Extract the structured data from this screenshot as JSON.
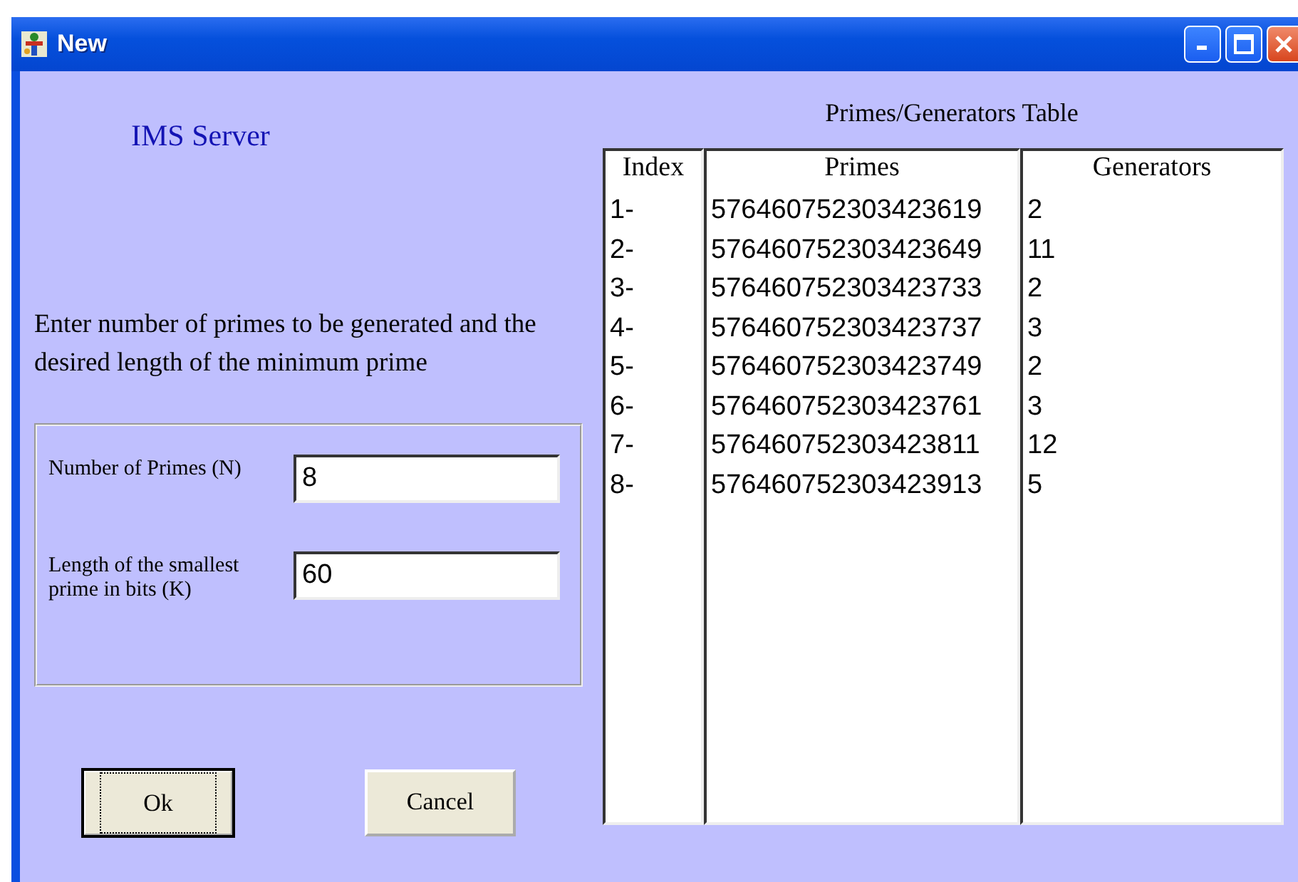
{
  "window": {
    "title": "New"
  },
  "heading": "IMS Server",
  "instructions": "Enter number of primes to be generated and the desired length of the minimum prime",
  "fields": [
    {
      "label": "Number of Primes (N)",
      "value": "8"
    },
    {
      "label": "Length of the smallest prime in bits (K)",
      "value": "60"
    }
  ],
  "buttons": [
    {
      "label": "Ok",
      "default": true
    },
    {
      "label": "Cancel",
      "default": false
    }
  ],
  "table": {
    "title": "Primes/Generators Table",
    "columns": [
      "Index",
      "Primes",
      "Generators"
    ],
    "rows": [
      [
        "1-",
        "576460752303423619",
        "2"
      ],
      [
        "2-",
        "576460752303423649",
        "11"
      ],
      [
        "3-",
        "576460752303423733",
        "2"
      ],
      [
        "4-",
        "576460752303423737",
        "3"
      ],
      [
        "5-",
        "576460752303423749",
        "2"
      ],
      [
        "6-",
        "576460752303423761",
        "3"
      ],
      [
        "7-",
        "576460752303423811",
        "12"
      ],
      [
        "8-",
        "576460752303423913",
        "5"
      ]
    ]
  }
}
